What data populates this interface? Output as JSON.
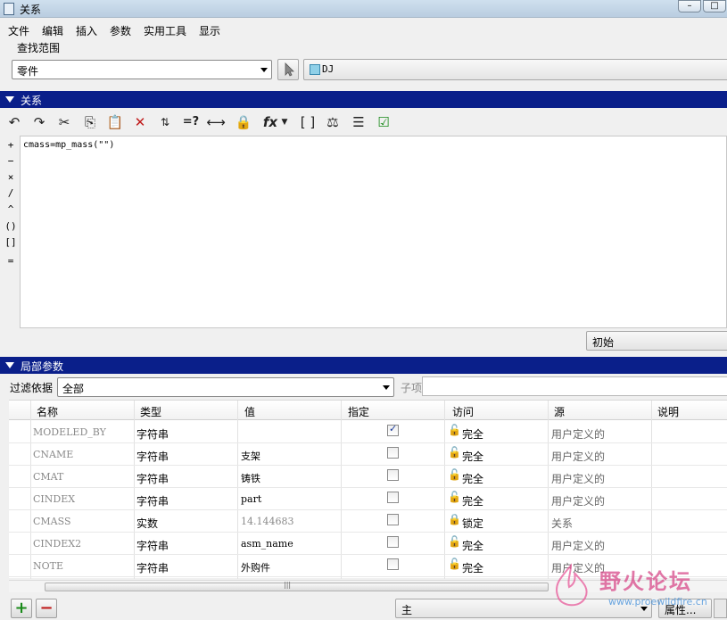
{
  "window": {
    "title": "关系"
  },
  "menu": [
    "文件",
    "编辑",
    "插入",
    "参数",
    "实用工具",
    "显示"
  ],
  "scope": {
    "label": "查找范围",
    "selected": "零件",
    "model": "DJ"
  },
  "relations_section": {
    "title": "关系"
  },
  "toolbar_icons": [
    "undo-icon",
    "redo-icon",
    "cut-icon",
    "copy-icon",
    "paste-icon",
    "delete-icon",
    "switch-dims-icon",
    "evaluate-icon",
    "insert-dimension-icon",
    "locked-relation-icon",
    "function-icon",
    "parameter-icon",
    "unit-icon",
    "sort-icon",
    "verify-icon"
  ],
  "operators": [
    "+",
    "−",
    "×",
    "/",
    "^",
    "()",
    "[]",
    "="
  ],
  "editor": {
    "code": "cmass=mp_mass(\"\")"
  },
  "initial_combo": "初始",
  "local_params_section": {
    "title": "局部参数"
  },
  "filter": {
    "label": "过滤依据",
    "selected": "全部",
    "sub_label": "子项"
  },
  "table": {
    "headers": [
      "名称",
      "类型",
      "值",
      "指定",
      "访问",
      "源",
      "说明"
    ],
    "rows": [
      {
        "name": "MODELED_BY",
        "type": "字符串",
        "value": "",
        "designate": true,
        "access": "完全",
        "source": "用户定义的"
      },
      {
        "name": "CNAME",
        "type": "字符串",
        "value": "支架",
        "designate": false,
        "access": "完全",
        "source": "用户定义的"
      },
      {
        "name": "CMAT",
        "type": "字符串",
        "value": "铸铁",
        "designate": false,
        "access": "完全",
        "source": "用户定义的"
      },
      {
        "name": "CINDEX",
        "type": "字符串",
        "value": "part",
        "designate": false,
        "access": "完全",
        "source": "用户定义的"
      },
      {
        "name": "CMASS",
        "type": "实数",
        "value": "14.144683",
        "designate": false,
        "access": "锁定",
        "source": "关系"
      },
      {
        "name": "CINDEX2",
        "type": "字符串",
        "value": "asm_name",
        "designate": false,
        "access": "完全",
        "source": "用户定义的"
      },
      {
        "name": "NOTE",
        "type": "字符串",
        "value": "外购件",
        "designate": false,
        "access": "完全",
        "source": "用户定义的"
      }
    ]
  },
  "bottom": {
    "main_combo": "主",
    "attr_button": "属性..."
  },
  "watermark": {
    "big": "野火论坛",
    "small": "www.proewildfire.cn"
  },
  "colors": {
    "section_bar": "#0a1f8a",
    "add": "#1a8a1a",
    "delete": "#c01a1a"
  }
}
